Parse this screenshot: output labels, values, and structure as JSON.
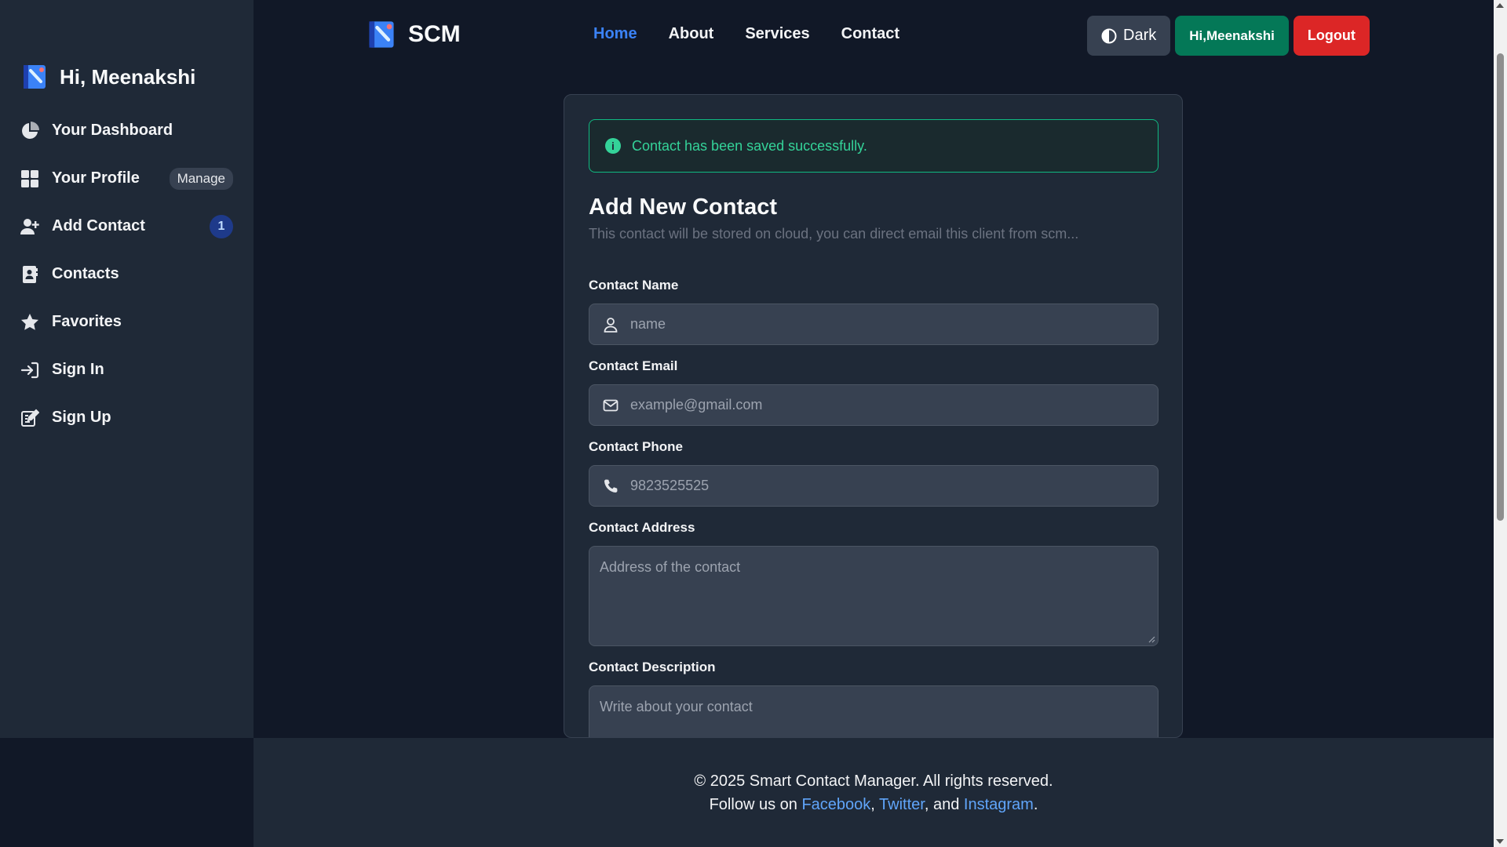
{
  "app": {
    "brand": "SCM"
  },
  "sidebar": {
    "greeting": "Hi, Meenakshi",
    "items": [
      {
        "label": "Your Dashboard",
        "icon": "pie-chart-icon"
      },
      {
        "label": "Your Profile",
        "icon": "grid-icon",
        "badge": "Manage"
      },
      {
        "label": "Add Contact",
        "icon": "user-plus-icon",
        "badge": "1"
      },
      {
        "label": "Contacts",
        "icon": "address-book-icon"
      },
      {
        "label": "Favorites",
        "icon": "star-icon"
      },
      {
        "label": "Sign In",
        "icon": "sign-in-icon"
      },
      {
        "label": "Sign Up",
        "icon": "edit-icon"
      }
    ]
  },
  "navbar": {
    "links": [
      {
        "label": "Home",
        "active": true
      },
      {
        "label": "About"
      },
      {
        "label": "Services"
      },
      {
        "label": "Contact"
      }
    ],
    "theme_label": "Dark",
    "user_label": "Hi,Meenakshi",
    "logout_label": "Logout"
  },
  "form": {
    "alert": "Contact has been saved successfully.",
    "title": "Add New Contact",
    "subtitle": "This contact will be stored on cloud, you can direct email this client from scm...",
    "name": {
      "label": "Contact Name",
      "placeholder": "name",
      "value": ""
    },
    "email": {
      "label": "Contact Email",
      "placeholder": "example@gmail.com",
      "value": ""
    },
    "phone": {
      "label": "Contact Phone",
      "placeholder": "9823525525",
      "value": ""
    },
    "address": {
      "label": "Contact Address",
      "placeholder": "Address of the contact",
      "value": ""
    },
    "description": {
      "label": "Contact Description",
      "placeholder": "Write about your contact",
      "value": ""
    }
  },
  "footer": {
    "copyright": "© 2025 Smart Contact Manager. All rights reserved.",
    "follow_prefix": "Follow us on ",
    "facebook": "Facebook",
    "sep1": ", ",
    "twitter": "Twitter",
    "sep2": ", and ",
    "instagram": "Instagram",
    "suffix": "."
  },
  "colors": {
    "background": "#111827",
    "panel": "#1f2937",
    "accent": "#3b82f6",
    "success": "#10b981",
    "user_button": "#047857",
    "logout_button": "#dc2626"
  }
}
